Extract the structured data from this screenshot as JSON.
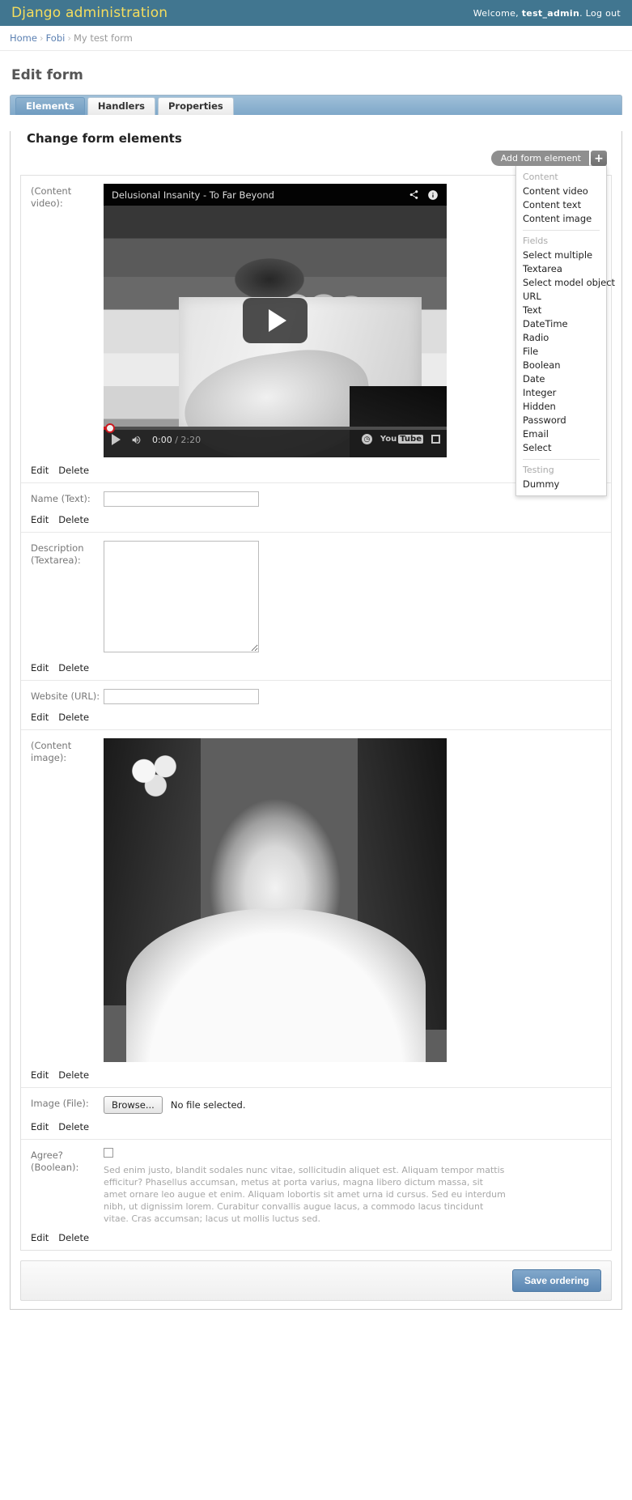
{
  "header": {
    "site_title": "Django administration",
    "welcome_prefix": "Welcome,",
    "username": "test_admin",
    "welcome_suffix": ".",
    "logout_label": "Log out"
  },
  "breadcrumbs": {
    "home": "Home",
    "app": "Fobi",
    "current": "My test form",
    "separator": "›"
  },
  "page": {
    "title": "Edit form",
    "section_title": "Change form elements"
  },
  "tabs": [
    {
      "label": "Elements",
      "active": true
    },
    {
      "label": "Handlers",
      "active": false
    },
    {
      "label": "Properties",
      "active": false
    }
  ],
  "add_element": {
    "button_label": "Add form element",
    "plus_icon": "+",
    "groups": [
      {
        "name": "Content",
        "items": [
          "Content video",
          "Content text",
          "Content image"
        ]
      },
      {
        "name": "Fields",
        "items": [
          "Select multiple",
          "Textarea",
          "Select model object",
          "URL",
          "Text",
          "DateTime",
          "Radio",
          "File",
          "Boolean",
          "Date",
          "Integer",
          "Hidden",
          "Password",
          "Email",
          "Select"
        ]
      },
      {
        "name": "Testing",
        "items": [
          "Dummy"
        ]
      }
    ]
  },
  "actions": {
    "edit": "Edit",
    "delete": "Delete"
  },
  "elements": {
    "video": {
      "label": "(Content\nvideo):",
      "title": "Delusional Insanity - To Far Beyond",
      "current_time": "0:00",
      "time_separator": "/",
      "duration": "2:20",
      "youtube_label": "You",
      "youtube_box": "Tube"
    },
    "name": {
      "label": "Name (Text):",
      "value": "",
      "placeholder": ""
    },
    "description": {
      "label": "Description\n(Textarea):",
      "value": "",
      "placeholder": ""
    },
    "website": {
      "label": "Website (URL):",
      "value": "",
      "placeholder": ""
    },
    "image": {
      "label": "(Content\nimage):"
    },
    "file": {
      "label": "Image (File):",
      "browse_label": "Browse...",
      "status": "No file selected."
    },
    "boolean": {
      "label": "Agree?\n(Boolean):",
      "checked": false,
      "help_text": "Sed enim justo, blandit sodales nunc vitae, sollicitudin aliquet est. Aliquam tempor mattis efficitur? Phasellus accumsan, metus at porta varius, magna libero dictum massa, sit amet ornare leo augue et enim. Aliquam lobortis sit amet urna id cursus. Sed eu interdum nibh, ut dignissim lorem. Curabitur convallis augue lacus, a commodo lacus tincidunt vitae. Cras accumsan; lacus ut mollis luctus sed."
    }
  },
  "submit": {
    "save_ordering_label": "Save ordering"
  },
  "colors": {
    "header_bg": "#417690",
    "header_title": "#f5dd5d",
    "link": "#5b80b2",
    "tab_active_bg": "#7fa8c9",
    "save_button": "#5b87b3",
    "youtube_red": "#cc181e"
  }
}
